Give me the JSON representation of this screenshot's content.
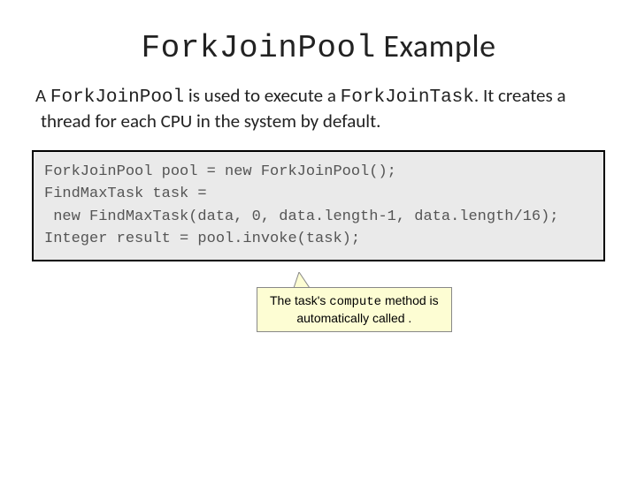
{
  "title": {
    "mono": "ForkJoinPool",
    "rest": " Example"
  },
  "desc": {
    "p1a": "A ",
    "p1b": "ForkJoinPool",
    "p1c": " is used to execute a ",
    "p1d": "ForkJoinTask",
    "p1e": ". It creates a thread for each CPU in the system by default."
  },
  "code": {
    "l1": "ForkJoinPool pool = new ForkJoinPool();",
    "l2": "FindMaxTask task =",
    "l3": " new FindMaxTask(data, 0, data.length-1, data.length/16);",
    "l4": "Integer result = pool.invoke(task);"
  },
  "callout": {
    "t1": "The task's ",
    "t2": "compute",
    "t3": " method is",
    "t4": "automatically called ."
  }
}
